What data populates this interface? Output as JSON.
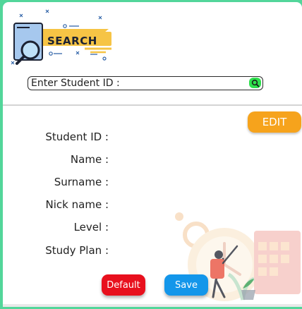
{
  "header": {
    "logo_text": "SEARCH"
  },
  "search": {
    "placeholder": "Enter Student ID :"
  },
  "form": {
    "edit_label": "EDIT",
    "fields": [
      {
        "label": "Student ID :"
      },
      {
        "label": "Name :"
      },
      {
        "label": "Surname :"
      },
      {
        "label": "Nick name :"
      },
      {
        "label": "Level :"
      },
      {
        "label": "Study Plan :"
      }
    ]
  },
  "actions": {
    "default_label": "Default",
    "save_label": "Save"
  },
  "icons": {
    "logo": "search-magnifier-document-icon",
    "search_button": "magnifier-icon"
  },
  "colors": {
    "background": "#52d69a",
    "edit": "#f6a31c",
    "default": "#e8101d",
    "save": "#1396ea",
    "search_button": "#2ee04c"
  }
}
